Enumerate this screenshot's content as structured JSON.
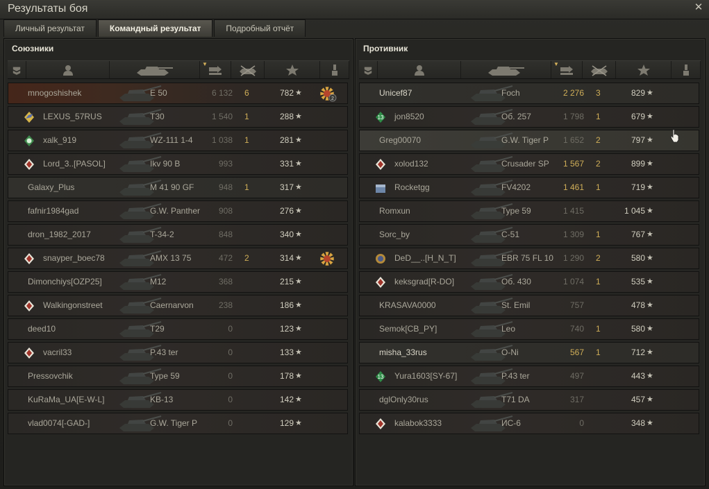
{
  "window": {
    "title": "Результаты боя"
  },
  "tabs": [
    {
      "label": "Личный результат",
      "active": false
    },
    {
      "label": "Командный результат",
      "active": true
    },
    {
      "label": "Подробный отчёт",
      "active": false
    }
  ],
  "allies": {
    "title": "Союзники",
    "rows": [
      {
        "name": "mnogoshishek",
        "vehicle": "E 50",
        "damage": "6 132",
        "frags": "6",
        "xp": "782",
        "badge": "",
        "style": "top",
        "damage_hi": false,
        "medal": "gold-medal-2"
      },
      {
        "name": "LEXUS_57RUS",
        "vehicle": "T30",
        "damage": "1 540",
        "frags": "1",
        "xp": "288",
        "badge": "tank-badge",
        "style": "",
        "damage_hi": false,
        "medal": ""
      },
      {
        "name": "xalk_919",
        "vehicle": "WZ-111 1-4",
        "damage": "1 038",
        "frags": "1",
        "xp": "281",
        "badge": "green-badge",
        "style": "",
        "damage_hi": false,
        "medal": ""
      },
      {
        "name": "Lord_3..[PASOL]",
        "vehicle": "Ikv 90 B",
        "damage": "993",
        "frags": "",
        "xp": "331",
        "badge": "rank-badge",
        "style": "",
        "damage_hi": false,
        "medal": ""
      },
      {
        "name": "Galaxy_Plus",
        "vehicle": "M 41 90 GF",
        "damage": "948",
        "frags": "1",
        "xp": "317",
        "badge": "",
        "style": "alt",
        "damage_hi": false,
        "medal": ""
      },
      {
        "name": "fafnir1984gad",
        "vehicle": "G.W. Panther",
        "damage": "908",
        "frags": "",
        "xp": "276",
        "badge": "",
        "style": "",
        "damage_hi": false,
        "medal": ""
      },
      {
        "name": "dron_1982_2017",
        "vehicle": "T-34-2",
        "damage": "848",
        "frags": "",
        "xp": "340",
        "badge": "",
        "style": "",
        "damage_hi": false,
        "medal": ""
      },
      {
        "name": "snayper_boec78",
        "vehicle": "AMX 13 75",
        "damage": "472",
        "frags": "2",
        "xp": "314",
        "badge": "rank-badge",
        "style": "",
        "damage_hi": false,
        "medal": "gold-medal"
      },
      {
        "name": "Dimonchiys[OZP25]",
        "vehicle": "M12",
        "damage": "368",
        "frags": "",
        "xp": "215",
        "badge": "",
        "style": "",
        "damage_hi": false,
        "medal": ""
      },
      {
        "name": "Walkingonstreet",
        "vehicle": "Caernarvon",
        "damage": "238",
        "frags": "",
        "xp": "186",
        "badge": "rank-badge",
        "style": "",
        "damage_hi": false,
        "medal": ""
      },
      {
        "name": "deed10",
        "vehicle": "T29",
        "damage": "0",
        "frags": "",
        "xp": "123",
        "badge": "",
        "style": "",
        "damage_hi": false,
        "medal": ""
      },
      {
        "name": "vacril33",
        "vehicle": "P.43 ter",
        "damage": "0",
        "frags": "",
        "xp": "133",
        "badge": "rank-badge",
        "style": "",
        "damage_hi": false,
        "medal": ""
      },
      {
        "name": "Pressovchik",
        "vehicle": "Type 59",
        "damage": "0",
        "frags": "",
        "xp": "178",
        "badge": "",
        "style": "",
        "damage_hi": false,
        "medal": ""
      },
      {
        "name": "KuRaMa_UA[E-W-L]",
        "vehicle": "KB-13",
        "damage": "0",
        "frags": "",
        "xp": "142",
        "badge": "",
        "style": "",
        "damage_hi": false,
        "medal": ""
      },
      {
        "name": "vlad0074[-GAD-]",
        "vehicle": "G.W. Tiger P",
        "damage": "0",
        "frags": "",
        "xp": "129",
        "badge": "",
        "style": "",
        "damage_hi": false,
        "medal": ""
      }
    ]
  },
  "enemies": {
    "title": "Противник",
    "rows": [
      {
        "name": "Unicef87",
        "vehicle": "Foch",
        "damage": "2 276",
        "frags": "3",
        "xp": "829",
        "badge": "",
        "style": "alt",
        "damage_hi": true,
        "medal": ""
      },
      {
        "name": "jon8520",
        "vehicle": "Об. 257",
        "damage": "1 798",
        "frags": "1",
        "xp": "679",
        "badge": "level-13-badge",
        "style": "",
        "damage_hi": false,
        "medal": ""
      },
      {
        "name": "Greg00070",
        "vehicle": "G.W. Tiger P",
        "damage": "1 652",
        "frags": "2",
        "xp": "797",
        "badge": "",
        "style": "hover",
        "damage_hi": false,
        "medal": ""
      },
      {
        "name": "xolod132",
        "vehicle": "Crusader SP",
        "damage": "1 567",
        "frags": "2",
        "xp": "899",
        "badge": "rank-badge",
        "style": "",
        "damage_hi": true,
        "medal": ""
      },
      {
        "name": "Rocketgg",
        "vehicle": "FV4202",
        "damage": "1 461",
        "frags": "1",
        "xp": "719",
        "badge": "box-badge",
        "style": "",
        "damage_hi": true,
        "medal": ""
      },
      {
        "name": "Romxun",
        "vehicle": "Type 59",
        "damage": "1 415",
        "frags": "",
        "xp": "1 045",
        "badge": "",
        "style": "",
        "damage_hi": false,
        "medal": ""
      },
      {
        "name": "Sorc_by",
        "vehicle": "C-51",
        "damage": "1 309",
        "frags": "1",
        "xp": "767",
        "badge": "",
        "style": "",
        "damage_hi": false,
        "medal": ""
      },
      {
        "name": "DeD__..[H_N_T]",
        "vehicle": "EBR 75 FL 10",
        "damage": "1 290",
        "frags": "2",
        "xp": "580",
        "badge": "gear-badge",
        "style": "",
        "damage_hi": false,
        "medal": ""
      },
      {
        "name": "keksgrad[R-DO]",
        "vehicle": "Об. 430",
        "damage": "1 074",
        "frags": "1",
        "xp": "535",
        "badge": "rank-badge",
        "style": "",
        "damage_hi": false,
        "medal": ""
      },
      {
        "name": "KRASAVA0000",
        "vehicle": "St. Emil",
        "damage": "757",
        "frags": "",
        "xp": "478",
        "badge": "",
        "style": "",
        "damage_hi": false,
        "medal": ""
      },
      {
        "name": "Semok[CB_PY]",
        "vehicle": "Leo",
        "damage": "740",
        "frags": "1",
        "xp": "580",
        "badge": "",
        "style": "",
        "damage_hi": false,
        "medal": ""
      },
      {
        "name": "misha_33rus",
        "vehicle": "O-Ni",
        "damage": "567",
        "frags": "1",
        "xp": "712",
        "badge": "",
        "style": "alt",
        "damage_hi": true,
        "medal": ""
      },
      {
        "name": "Yura1603[SY-67]",
        "vehicle": "P.43 ter",
        "damage": "497",
        "frags": "",
        "xp": "443",
        "badge": "level-13-badge",
        "style": "",
        "damage_hi": false,
        "medal": ""
      },
      {
        "name": "dglOnly30rus",
        "vehicle": "T71 DA",
        "damage": "317",
        "frags": "",
        "xp": "457",
        "badge": "",
        "style": "",
        "damage_hi": false,
        "medal": ""
      },
      {
        "name": "kalabok3333",
        "vehicle": "ИС-6",
        "damage": "0",
        "frags": "",
        "xp": "348",
        "badge": "rank-badge",
        "style": "",
        "damage_hi": false,
        "medal": ""
      }
    ]
  },
  "columns": [
    {
      "id": "squad",
      "icon": "squad-icon",
      "width": 27
    },
    {
      "id": "player",
      "icon": "player-icon",
      "width": 120
    },
    {
      "id": "vehicle",
      "icon": "tank-icon",
      "width": 130
    },
    {
      "id": "damage",
      "icon": "damage-icon",
      "width": 45
    },
    {
      "id": "frags",
      "icon": "frags-icon",
      "width": 48
    },
    {
      "id": "xp",
      "icon": "star-icon",
      "width": 80
    },
    {
      "id": "medals",
      "icon": "medal-icon",
      "width": 42
    }
  ],
  "star_glyph": "★",
  "badge_level_text": "13",
  "medal_count": "2",
  "colors": {
    "accent": "#cfae58",
    "text": "#aaa79a"
  }
}
